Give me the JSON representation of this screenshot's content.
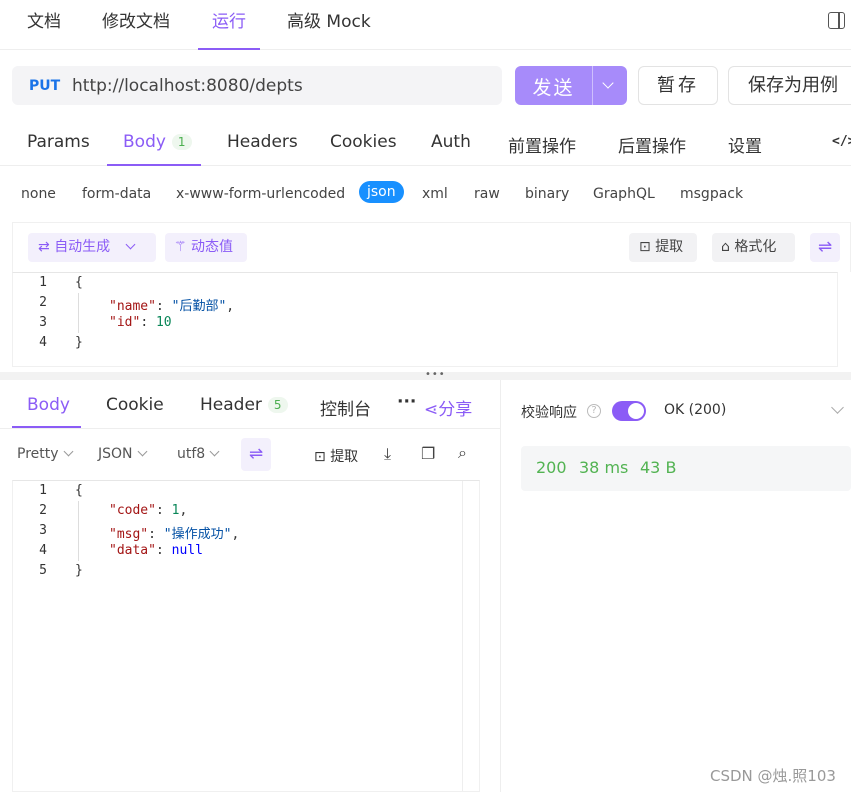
{
  "top_tabs": [
    {
      "label": "文档"
    },
    {
      "label": "修改文档"
    },
    {
      "label": "运行"
    },
    {
      "label": "高级 Mock"
    }
  ],
  "request": {
    "method": "PUT",
    "url": "http://localhost:8080/depts",
    "send_label": "发送",
    "save_label": "暂存",
    "save_case_label": "保存为用例"
  },
  "request_tabs": [
    {
      "label": "Params"
    },
    {
      "label": "Body",
      "count": "1"
    },
    {
      "label": "Headers"
    },
    {
      "label": "Cookies"
    },
    {
      "label": "Auth"
    },
    {
      "label": "前置操作"
    },
    {
      "label": "后置操作"
    },
    {
      "label": "设置"
    }
  ],
  "body_types": [
    "none",
    "form-data",
    "x-www-form-urlencoded",
    "json",
    "xml",
    "raw",
    "binary",
    "GraphQL",
    "msgpack"
  ],
  "body_type_selected": "json",
  "req_toolbar": {
    "auto_generate": "自动生成",
    "dynamic_value": "动态值",
    "extract": "提取",
    "format": "格式化"
  },
  "request_body": {
    "line_numbers": [
      "1",
      "2",
      "3",
      "4"
    ],
    "name_key": "\"name\"",
    "name_value": "\"后勤部\"",
    "id_key": "\"id\"",
    "id_value": "10"
  },
  "response_tabs": [
    {
      "label": "Body"
    },
    {
      "label": "Cookie"
    },
    {
      "label": "Header",
      "count": "5"
    },
    {
      "label": "控制台"
    }
  ],
  "share_label": "分享",
  "resp_toolbar": {
    "pretty": "Pretty",
    "format": "JSON",
    "encoding": "utf8",
    "extract": "提取"
  },
  "response_body": {
    "line_numbers": [
      "1",
      "2",
      "3",
      "4",
      "5"
    ],
    "code_key": "\"code\"",
    "code_value": "1",
    "msg_key": "\"msg\"",
    "msg_value": "\"操作成功\"",
    "data_key": "\"data\"",
    "data_value": "null"
  },
  "validation": {
    "label": "校验响应",
    "status_text": "OK (200)",
    "toggle_on": true
  },
  "stats": {
    "status": "200",
    "time": "38 ms",
    "size": "43 B"
  },
  "watermark": "CSDN @烛.照103",
  "colors": {
    "accent": "#8b5cf6",
    "send_button": "#a78bfa",
    "selected_type": "#1890ff",
    "success": "#52b352"
  }
}
